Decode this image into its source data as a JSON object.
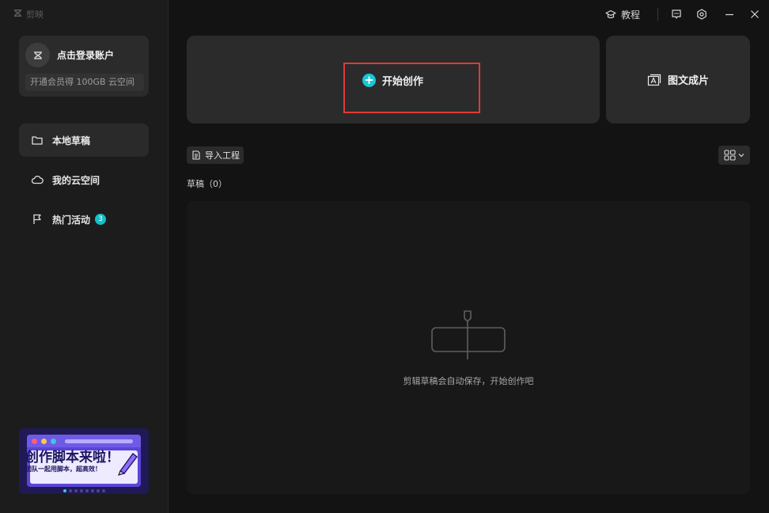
{
  "app": {
    "title": "剪映"
  },
  "account": {
    "login_label": "点击登录账户",
    "vip_text": "开通会员得 100GB 云空间"
  },
  "sidebar": {
    "items": [
      {
        "label": "本地草稿",
        "icon": "folder-icon",
        "active": true
      },
      {
        "label": "我的云空间",
        "icon": "cloud-icon",
        "active": false
      },
      {
        "label": "热门活动",
        "icon": "flag-icon",
        "active": false,
        "badge": "3"
      }
    ]
  },
  "banner": {
    "title": "创作脚本来啦！",
    "subtitle": "团队一起用脚本，超高效！",
    "page_count": 8,
    "active_page": 0
  },
  "topbar": {
    "tutorial_label": "教程",
    "icons": [
      "graduation-cap-icon",
      "feedback-icon",
      "settings-icon",
      "minimize-icon",
      "close-icon"
    ]
  },
  "main": {
    "create_label": "开始创作",
    "imgtext_label": "图文成片",
    "import_label": "导入工程",
    "drafts_label": "草稿（0）",
    "empty_text": "剪辑草稿会自动保存，开始创作吧"
  },
  "colors": {
    "accent": "#1ac6d3",
    "highlight": "#e03a3a",
    "banner_bg": "#5b45d8"
  }
}
